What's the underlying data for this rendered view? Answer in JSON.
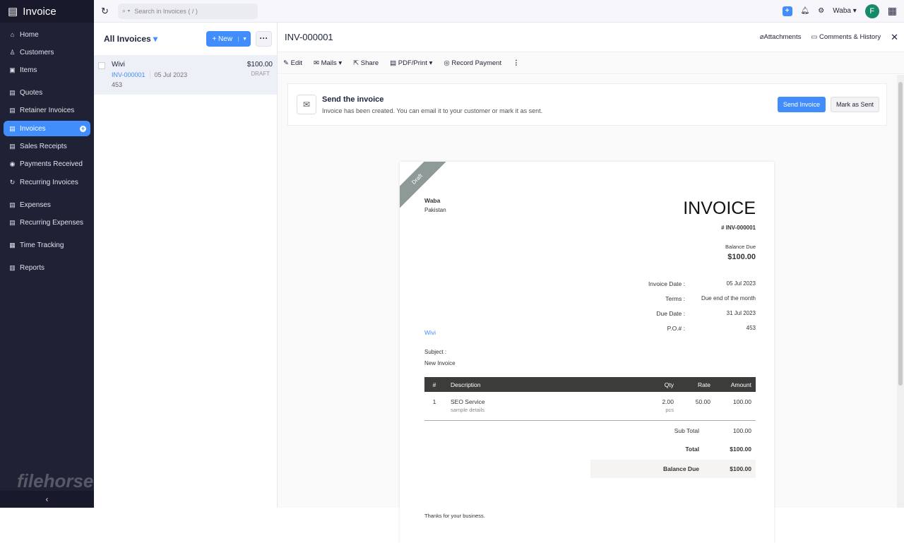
{
  "app": {
    "title": "Invoice",
    "watermark": "filehorse.com"
  },
  "sidebar": {
    "items": [
      {
        "label": "Home",
        "icon": "⌂"
      },
      {
        "label": "Customers",
        "icon": "♙"
      },
      {
        "label": "Items",
        "icon": "▣"
      },
      {
        "label": "Quotes",
        "icon": "▤"
      },
      {
        "label": "Retainer Invoices",
        "icon": "▤"
      },
      {
        "label": "Invoices",
        "icon": "▤"
      },
      {
        "label": "Sales Receipts",
        "icon": "▤"
      },
      {
        "label": "Payments Received",
        "icon": "◉"
      },
      {
        "label": "Recurring Invoices",
        "icon": "↻"
      },
      {
        "label": "Expenses",
        "icon": "▤"
      },
      {
        "label": "Recurring Expenses",
        "icon": "▤"
      },
      {
        "label": "Time Tracking",
        "icon": "▦"
      },
      {
        "label": "Reports",
        "icon": "▥"
      }
    ]
  },
  "topbar": {
    "search_placeholder": "Search in Invoices ( / )",
    "org": "Waba",
    "avatar": "F"
  },
  "list": {
    "title": "All Invoices",
    "new_label": "+ New",
    "rows": [
      {
        "customer": "Wivi",
        "amount": "$100.00",
        "number": "INV-000001",
        "date": "05 Jul 2023",
        "status": "DRAFT",
        "ref": "453"
      }
    ]
  },
  "detail": {
    "title": "INV-000001",
    "attachments": "Attachments",
    "comments": "Comments & History",
    "toolbar": {
      "edit": "Edit",
      "mails": "Mails",
      "share": "Share",
      "pdf": "PDF/Print",
      "record": "Record Payment"
    },
    "banner": {
      "title": "Send the invoice",
      "subtitle": "Invoice has been created. You can email it to your customer or mark it as sent.",
      "send": "Send Invoice",
      "mark": "Mark as Sent"
    }
  },
  "invoice": {
    "ribbon": "Draft",
    "org": "Waba",
    "country": "Pakistan",
    "heading": "INVOICE",
    "number": "# INV-000001",
    "balance_label": "Balance Due",
    "balance": "$100.00",
    "meta": [
      {
        "label": "Invoice Date :",
        "value": "05 Jul 2023"
      },
      {
        "label": "Terms :",
        "value": "Due end of the month"
      },
      {
        "label": "Due Date :",
        "value": "31 Jul 2023"
      },
      {
        "label": "P.O.# :",
        "value": "453"
      }
    ],
    "bill_to": "Wivi",
    "subject_label": "Subject :",
    "subject": "New Invoice",
    "columns": [
      "#",
      "Description",
      "Qty",
      "Rate",
      "Amount"
    ],
    "items": [
      {
        "n": "1",
        "desc": "SEO Service",
        "details": "sample details",
        "qty": "2.00",
        "unit": "pcs",
        "rate": "50.00",
        "amount": "100.00"
      }
    ],
    "subtotal_label": "Sub Total",
    "subtotal": "100.00",
    "total_label": "Total",
    "total": "$100.00",
    "due_label": "Balance Due",
    "due": "$100.00",
    "notes": "Thanks for your business."
  }
}
